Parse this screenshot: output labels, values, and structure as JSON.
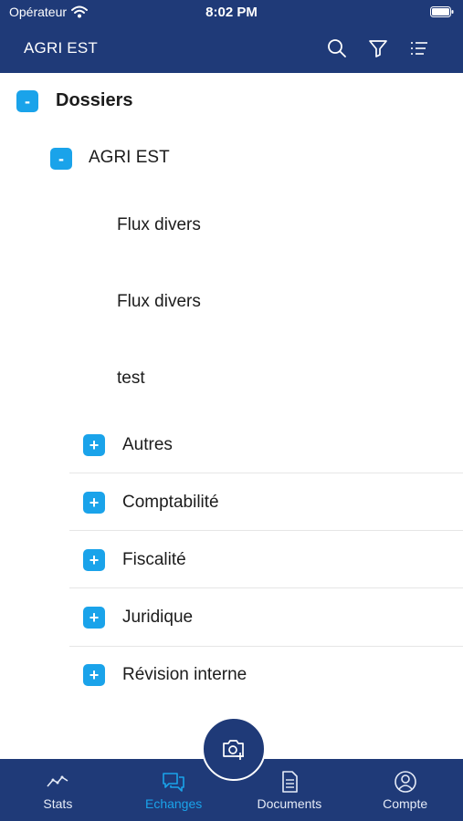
{
  "status_bar": {
    "carrier": "Opérateur",
    "time": "8:02 PM"
  },
  "nav_bar": {
    "title": "AGRI EST",
    "icons": [
      "search-icon",
      "filter-icon",
      "list-icon"
    ]
  },
  "tree": {
    "root": {
      "label": "Dossiers",
      "toggle": "-"
    },
    "client": {
      "label": "AGRI EST",
      "toggle": "-"
    },
    "files": [
      {
        "label": "Flux divers"
      },
      {
        "label": "Flux divers"
      },
      {
        "label": "test"
      }
    ],
    "folders": [
      {
        "label": "Autres",
        "toggle": "+"
      },
      {
        "label": "Comptabilité",
        "toggle": "+"
      },
      {
        "label": "Fiscalité",
        "toggle": "+"
      },
      {
        "label": "Juridique",
        "toggle": "+"
      },
      {
        "label": "Révision interne",
        "toggle": "+"
      }
    ]
  },
  "fab": {
    "icon": "camera-add-icon"
  },
  "tab_bar": {
    "items": [
      {
        "label": "Stats",
        "icon": "stats-icon",
        "active": false
      },
      {
        "label": "Echanges",
        "icon": "chat-icon",
        "active": true
      },
      {
        "label": "Documents",
        "icon": "document-icon",
        "active": false
      },
      {
        "label": "Compte",
        "icon": "account-icon",
        "active": false
      }
    ]
  },
  "colors": {
    "primary": "#1f3a78",
    "accent": "#1aa3ea",
    "text": "#1c1c1c",
    "divider": "#e6e6e6"
  }
}
